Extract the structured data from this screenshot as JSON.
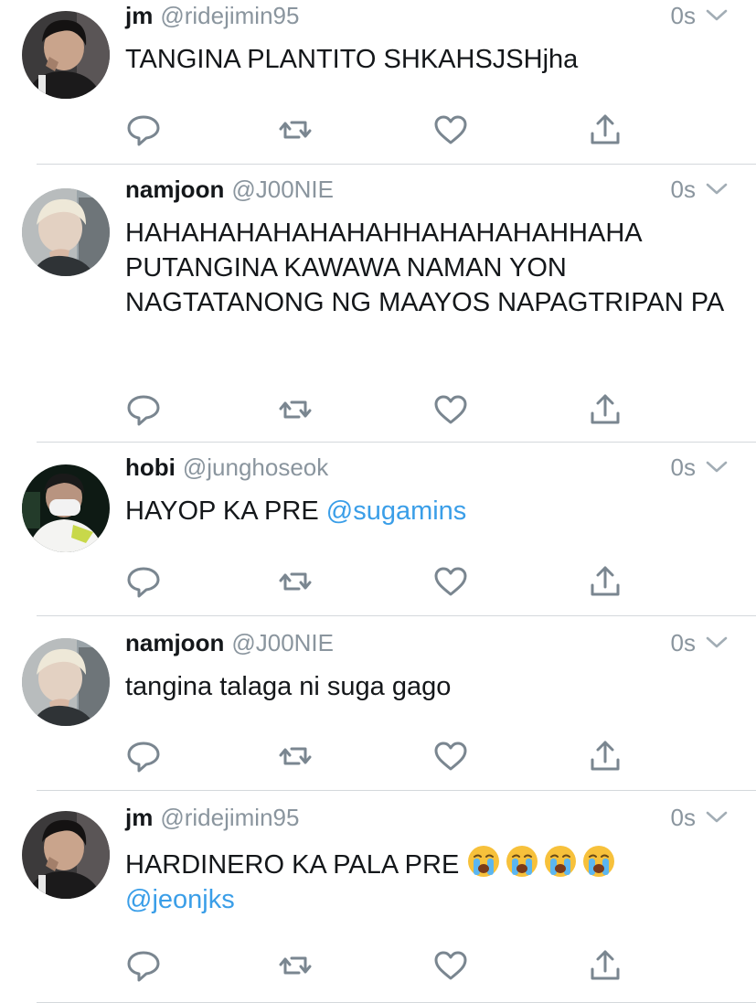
{
  "tweets": [
    {
      "name": "jm",
      "handle": "@ridejimin95",
      "time": "0s",
      "avatar": "avatar-jm",
      "segments": [
        {
          "text": "TANGINA PLANTITO SHKAHSJSHjha",
          "type": "text"
        }
      ]
    },
    {
      "name": "namjoon",
      "handle": "@J00NIE",
      "time": "0s",
      "avatar": "avatar-namjoon",
      "segments": [
        {
          "text": "HAHAHAHAHAHAHAHHAHAHAHAHHAHA PUTANGINA KAWAWA NAMAN YON NAGTATANONG NG MAAYOS NAPAGTRIPAN PA",
          "type": "text"
        }
      ]
    },
    {
      "name": "hobi",
      "handle": "@junghoseok",
      "time": "0s",
      "avatar": "avatar-hobi",
      "segments": [
        {
          "text": "HAYOP KA PRE ",
          "type": "text"
        },
        {
          "text": "@sugamins",
          "type": "mention"
        }
      ]
    },
    {
      "name": "namjoon",
      "handle": "@J00NIE",
      "time": "0s",
      "avatar": "avatar-namjoon",
      "segments": [
        {
          "text": "tangina talaga ni suga gago",
          "type": "text"
        }
      ]
    },
    {
      "name": "jm",
      "handle": "@ridejimin95",
      "time": "0s",
      "avatar": "avatar-jm",
      "segments": [
        {
          "text": "HARDINERO KA PALA PRE ",
          "type": "text"
        },
        {
          "text": "loudly-crying-face",
          "type": "emoji"
        },
        {
          "text": "loudly-crying-face",
          "type": "emoji"
        },
        {
          "text": "loudly-crying-face",
          "type": "emoji"
        },
        {
          "text": "loudly-crying-face",
          "type": "emoji"
        },
        {
          "text": "\n",
          "type": "text"
        },
        {
          "text": "@jeonjks",
          "type": "mention"
        }
      ]
    }
  ],
  "icons": {
    "reply": "reply-icon",
    "retweet": "retweet-icon",
    "like": "heart-icon",
    "share": "share-icon",
    "menu": "chevron-down-icon"
  },
  "colors": {
    "text": "#14171a",
    "muted": "#8a959e",
    "mention": "#3a9ee8",
    "separator": "#d4d8dc",
    "icon": "#7a8690"
  }
}
